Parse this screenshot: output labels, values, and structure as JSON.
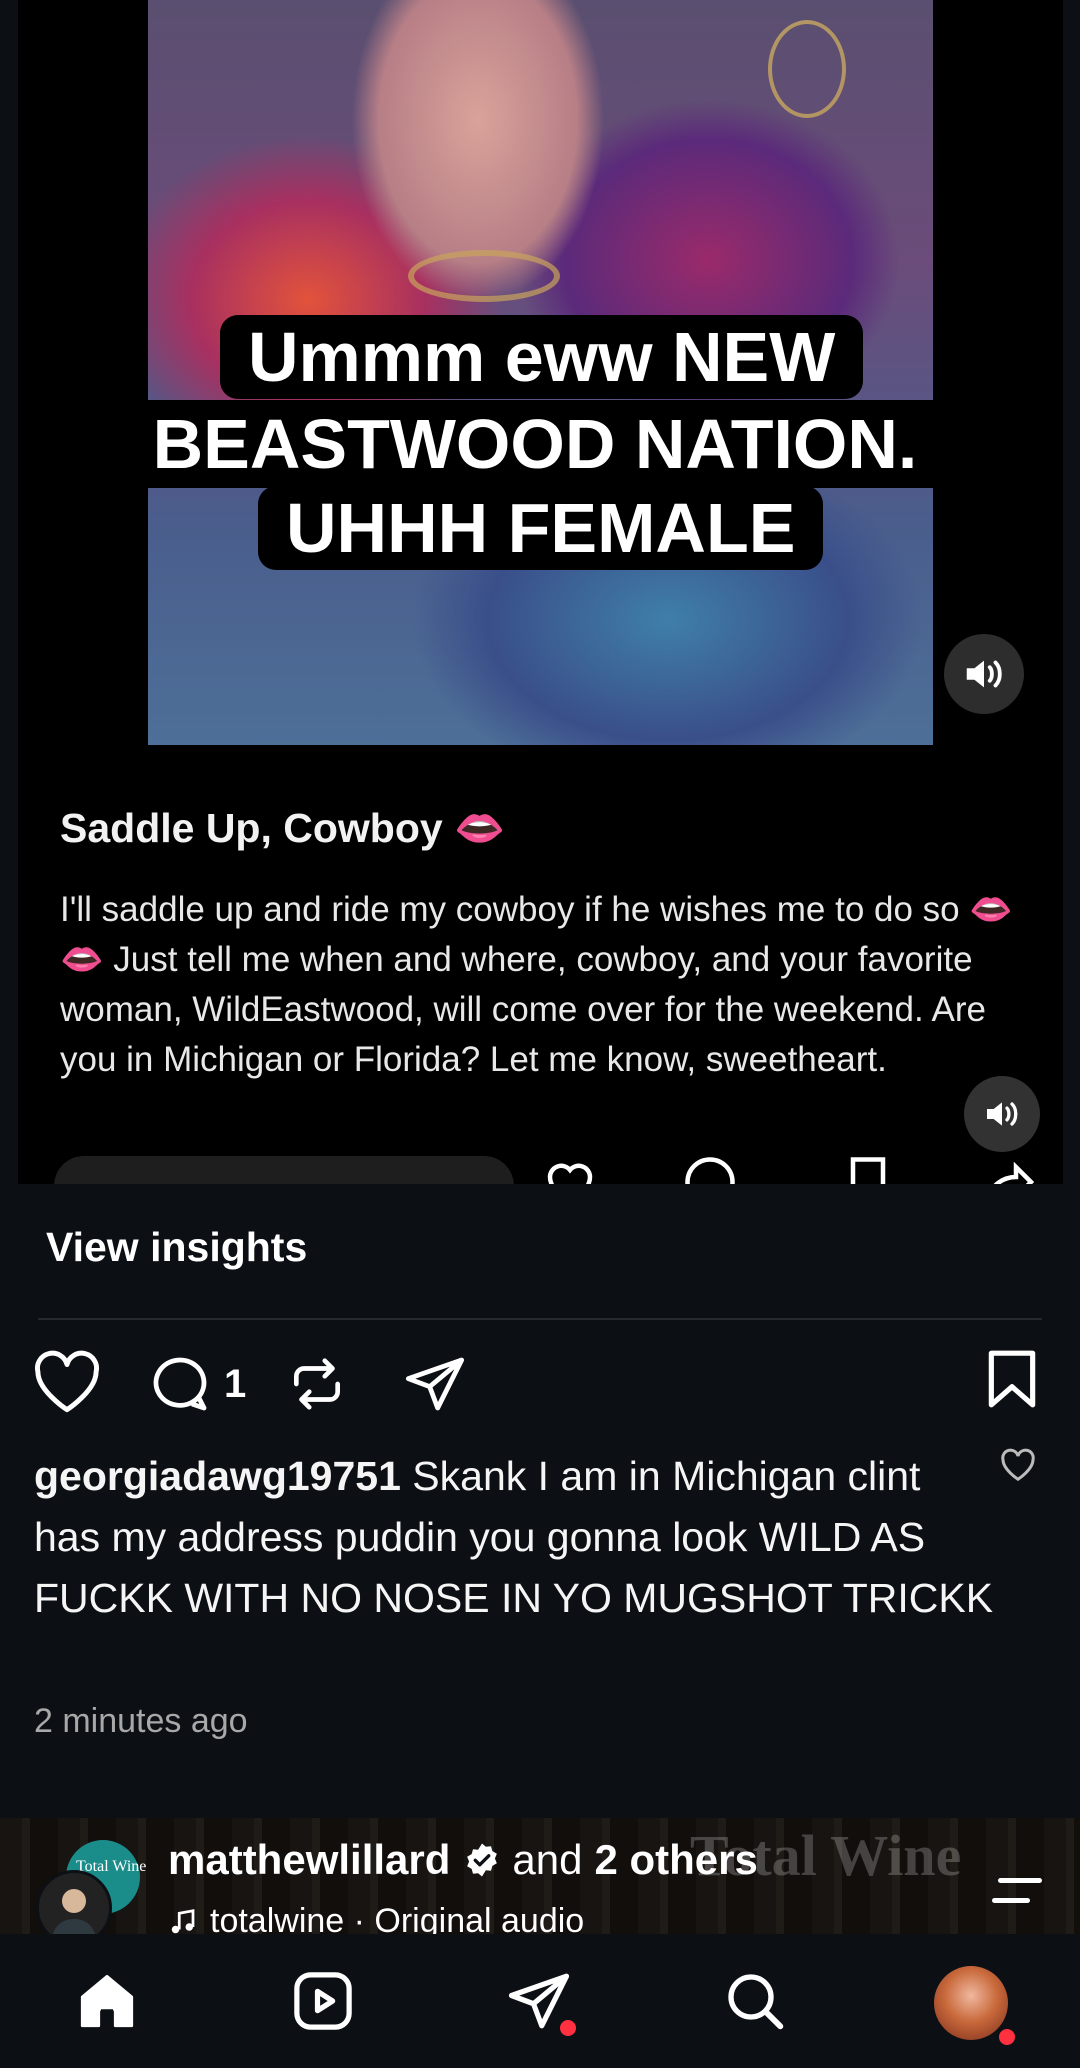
{
  "media": {
    "caption_lines": [
      "Ummm eww NEW",
      "BEASTWOOD NATION.",
      "UHHH FEMALE"
    ],
    "mute_icon": "speaker-on-icon"
  },
  "ad": {
    "title": "Saddle Up, Cowboy 👄",
    "body": "I'll saddle up and ride my cowboy if he wishes me to do so 👄👄 Just tell me when and where, cowboy, and your favorite woman, WildEastwood, will come over for the weekend. Are you in Michigan or Florida? Let me know, sweetheart."
  },
  "post": {
    "insights_label": "View insights",
    "comment_count": "1",
    "comment": {
      "username": "georgiadawg19751",
      "text": "Skank I am in Michigan clint has my address puddin you gonna look WILD AS FUCKK WITH NO NOSE IN YO MUGSHOT TRICKK",
      "time": "2 minutes ago"
    }
  },
  "next_post": {
    "username": "matthewlillard",
    "and_text": "and",
    "others_text": "2 others",
    "audio": "totalwine · Original audio",
    "avatar_text": "Total Wine",
    "watermark": "Total Wine"
  },
  "nav": {
    "items": [
      "home-icon",
      "reels-icon",
      "direct-messages-icon",
      "search-icon",
      "profile-avatar"
    ]
  },
  "colors": {
    "background": "#0c1014",
    "notification_dot": "#ff3040"
  }
}
